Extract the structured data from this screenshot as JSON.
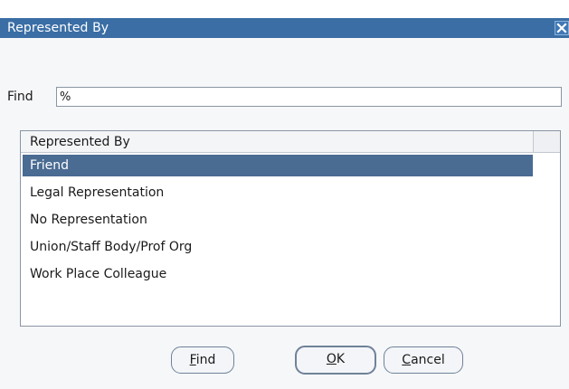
{
  "window": {
    "title": "Represented By"
  },
  "find": {
    "label": "Find",
    "value": "%"
  },
  "list": {
    "header": "Represented By",
    "items": [
      {
        "label": "Friend",
        "selected": true
      },
      {
        "label": "Legal Representation",
        "selected": false
      },
      {
        "label": "No Representation",
        "selected": false
      },
      {
        "label": "Union/Staff Body/Prof Org",
        "selected": false
      },
      {
        "label": "Work Place Colleague",
        "selected": false
      }
    ]
  },
  "buttons": {
    "find": {
      "mnemonic": "F",
      "rest": "ind"
    },
    "ok": {
      "mnemonic": "O",
      "rest": "K"
    },
    "cancel": {
      "mnemonic": "C",
      "rest": "ancel"
    }
  },
  "colors": {
    "titlebar": "#3a6ea5",
    "selection": "#4a6b92",
    "background": "#f6f7f9"
  },
  "icons": {
    "close": "close-icon"
  }
}
